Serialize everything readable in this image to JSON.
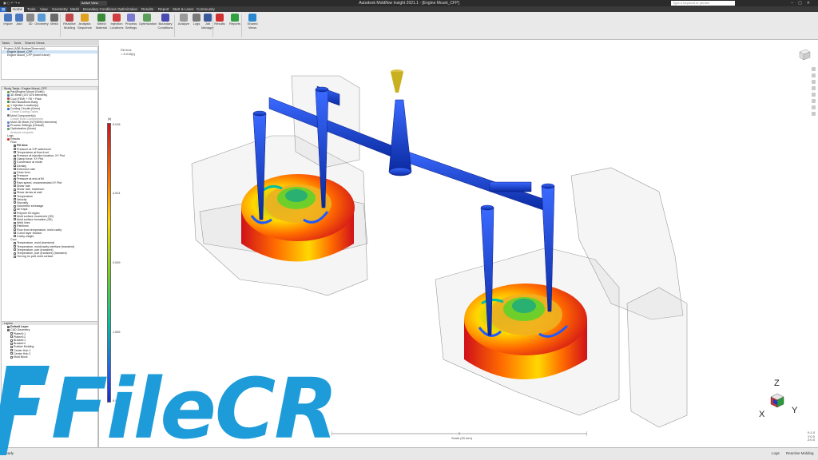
{
  "titlebar": {
    "title": "Autodesk Moldflow Insight 2021.1 - [Engine Mount_CFP]",
    "search_placeholder": "Type a keyword or phrase",
    "active_view": "Active View"
  },
  "ribbon_tabs": [
    "Home",
    "Tools",
    "View",
    "Geometry",
    "Mesh",
    "Boundary Conditions",
    "Optimization",
    "Results",
    "Report",
    "Start & Learn",
    "Community"
  ],
  "ribbon_buttons": [
    {
      "label": "Import",
      "color": "#4a78c0"
    },
    {
      "label": "Add",
      "color": "#4a78c0"
    },
    {
      "label": "3D",
      "color": "#8a8a8a"
    },
    {
      "label": "Geometry",
      "color": "#5a9bd5"
    },
    {
      "label": "Mesh",
      "color": "#6a6a6a"
    },
    {
      "label": "Reactive Molding",
      "color": "#c04848"
    },
    {
      "label": "Analysis Sequence",
      "color": "#e0a020"
    },
    {
      "label": "Select Material",
      "color": "#3a8a3a"
    },
    {
      "label": "Injection Locations",
      "color": "#d04040"
    },
    {
      "label": "Process Settings",
      "color": "#7a7ad0"
    },
    {
      "label": "Optimization",
      "color": "#5aa05a"
    },
    {
      "label": "Boundary Conditions",
      "color": "#4a4ab0"
    },
    {
      "label": "Analyze",
      "color": "#9a9a9a"
    },
    {
      "label": "Logs",
      "color": "#7a7a7a"
    },
    {
      "label": "Job Manager",
      "color": "#3a5a9a"
    },
    {
      "label": "Results",
      "color": "#d03030"
    },
    {
      "label": "Reports",
      "color": "#30a040"
    },
    {
      "label": "Shared Views",
      "color": "#2a88d0"
    }
  ],
  "panel_tabs": [
    "Tasks",
    "Tools",
    "Shared Views"
  ],
  "project": {
    "items": [
      "Project (ASB-RubberOthermold)",
      "Engine Mount_CFP",
      "Engine Mount_CFP (insert frame)"
    ]
  },
  "study_tasks": {
    "header": "Study Tasks : Engine Mount_CFP",
    "items": [
      "Part(Engine Mount (Grab))",
      "3D Mesh (207,676 elements)",
      "Cool (FEM) + Fill + Pack",
      "HDD Butadiene-Baby",
      "1 Injection Location(s)",
      "Cooling Circuits (None)",
      "Create Cooling Tubes",
      "Mold Component(s)",
      "Create Mold Components",
      "Mold 3D Mesh (N,F(5590) elements)",
      "Process Settings (Default)",
      "Optimization (None)",
      "Analysis complete",
      "Logs",
      "Results"
    ],
    "results": [
      "Flow",
      "Fill time",
      "Pressure at V/P switchover",
      "Temperature at flow front",
      "Pressure at injection location: XY Plot",
      "Clamp force: XY Plot",
      "Conversion at mode",
      "Density",
      "Extension rate",
      "Grow from",
      "Pressure",
      "Pressure at end of fill",
      "Ram speed, recommended:XY Plot",
      "Shear rate",
      "Shear rate, maximum",
      "Shear stress at wall",
      "Temperature",
      "Velocity",
      "Viscosity",
      "Volumetric shrinkage",
      "Air traps",
      "Polymer fill region",
      "Mold surface movement (3D)",
      "Mold surface formation (3D)",
      "Weld lines",
      "Pathlines",
      "Flow front temperature, mold cavity",
      "Cured layer fraction",
      "Cavity weight",
      "Cool",
      "Temperature, mold (transient)",
      "Temperature, mold/cavity interface (transient)",
      "Temperature, part (transient)",
      "Temperature, part (transient) (transient)",
      "Hot-mg no part mold contact"
    ]
  },
  "layers": {
    "header": "Layers",
    "items": [
      "Default Layer",
      "CAD Geometry",
      "Platen0:1",
      "Platen0:2",
      "Bracket:1",
      "Bracket:2",
      "Rubber Molding",
      "Center Hub 1",
      "Center Hub 2",
      "Mold Block"
    ]
  },
  "viewport": {
    "label_line1": "Fill time",
    "label_line2": "= 6.018[s]",
    "legend_unit": "[s]",
    "legend_values": [
      "6.018",
      "4.514",
      "3.009",
      "1.505",
      "0.0000"
    ],
    "scale_label": "Scale (20 mm)",
    "coords": [
      "X:1.0",
      "Y:0.0",
      "Z:0.0"
    ],
    "axis_labels": {
      "x": "X",
      "y": "Y",
      "z": "Z"
    }
  },
  "statusbar": {
    "left": "Ready",
    "right_logs": "Logs",
    "right_mode": "Reactive Molding"
  },
  "colors": {
    "runner": "#1240d0",
    "sprue": "#c9b020",
    "legend_high": "#d0101a",
    "legend_low": "#1a2ad0"
  },
  "watermark": "FileCR"
}
